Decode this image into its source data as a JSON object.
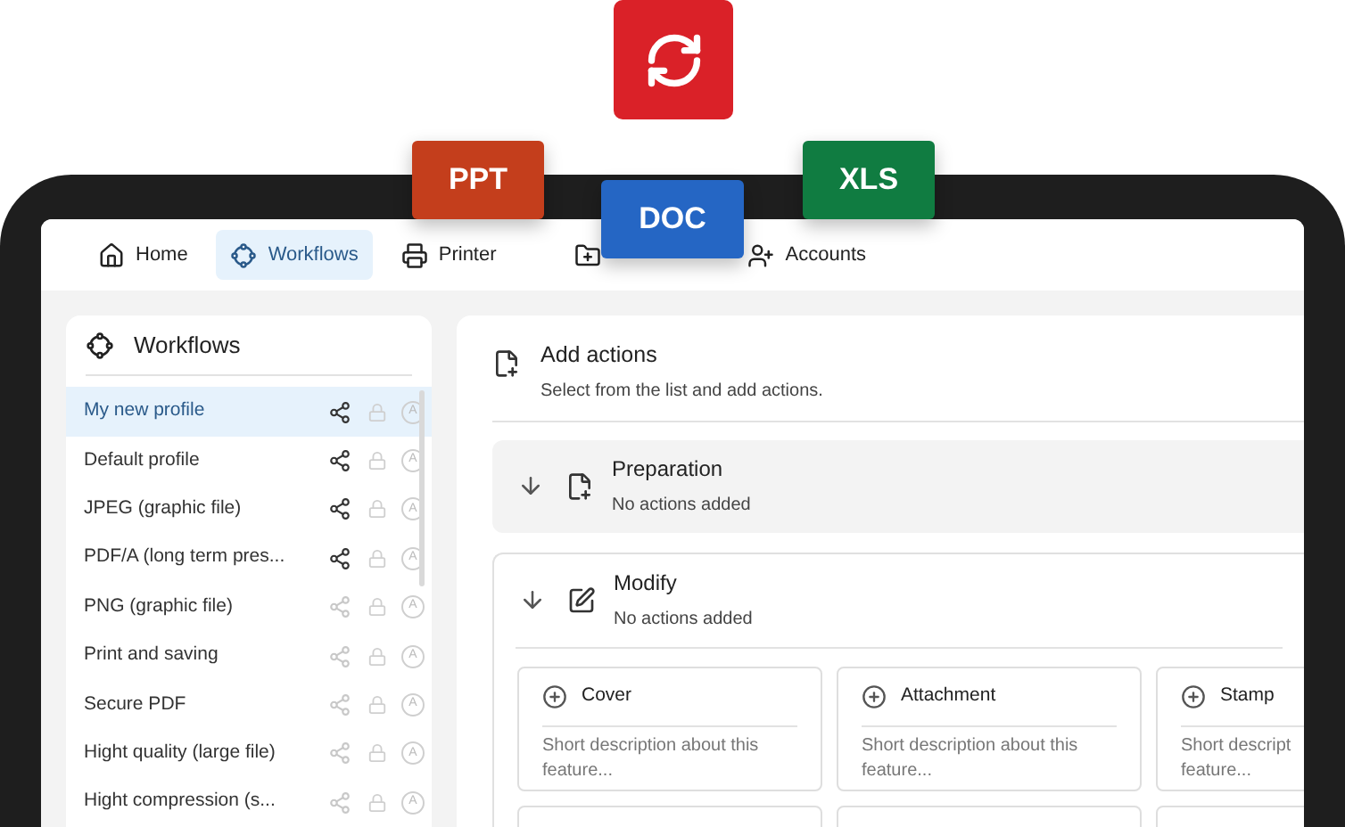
{
  "badges": [
    {
      "kind": "sync"
    },
    {
      "kind": "file",
      "label": "PPT",
      "color": "#c43e1c"
    },
    {
      "kind": "file",
      "label": "DOC",
      "color": "#2566c4"
    },
    {
      "kind": "file",
      "label": "XLS",
      "color": "#107c41"
    }
  ],
  "nav": [
    {
      "label": "Home",
      "selected": false
    },
    {
      "label": "Workflows",
      "selected": true
    },
    {
      "label": "Printer",
      "selected": false
    },
    {
      "selected": false
    },
    {
      "label": "Accounts",
      "selected": false
    }
  ],
  "sidebar": {
    "title": "Workflows",
    "items": [
      {
        "label": "My new profile",
        "selected": true,
        "shared": true,
        "badge": "A"
      },
      {
        "label": "Default profile",
        "selected": false,
        "shared": true,
        "badge": "A"
      },
      {
        "label": "JPEG (graphic file)",
        "selected": false,
        "shared": true,
        "badge": "A"
      },
      {
        "label": "PDF/A (long term pres...",
        "selected": false,
        "shared": true,
        "badge": "A"
      },
      {
        "label": "PNG (graphic file)",
        "selected": false,
        "shared": false,
        "badge": "A"
      },
      {
        "label": "Print and saving",
        "selected": false,
        "shared": false,
        "badge": "A"
      },
      {
        "label": "Secure PDF",
        "selected": false,
        "shared": false,
        "badge": "A"
      },
      {
        "label": "Hight quality (large file)",
        "selected": false,
        "shared": false,
        "badge": "A"
      },
      {
        "label": "Hight compression (s...",
        "selected": false,
        "shared": false,
        "badge": "A"
      }
    ]
  },
  "main": {
    "title": "Add actions",
    "subtitle": "Select from the list and add actions.",
    "sections": [
      {
        "kind": "collapsed",
        "title": "Preparation",
        "status": "No actions added"
      },
      {
        "kind": "expanded",
        "title": "Modify",
        "status": "No actions added",
        "cards": [
          {
            "title": "Cover",
            "description_lines": [
              "Short description about this",
              "feature..."
            ]
          },
          {
            "title": "Attachment",
            "description_lines": [
              "Short description about this",
              "feature..."
            ]
          },
          {
            "title": "Stamp",
            "description_lines": [
              "Short descript",
              "feature..."
            ]
          }
        ]
      }
    ]
  }
}
